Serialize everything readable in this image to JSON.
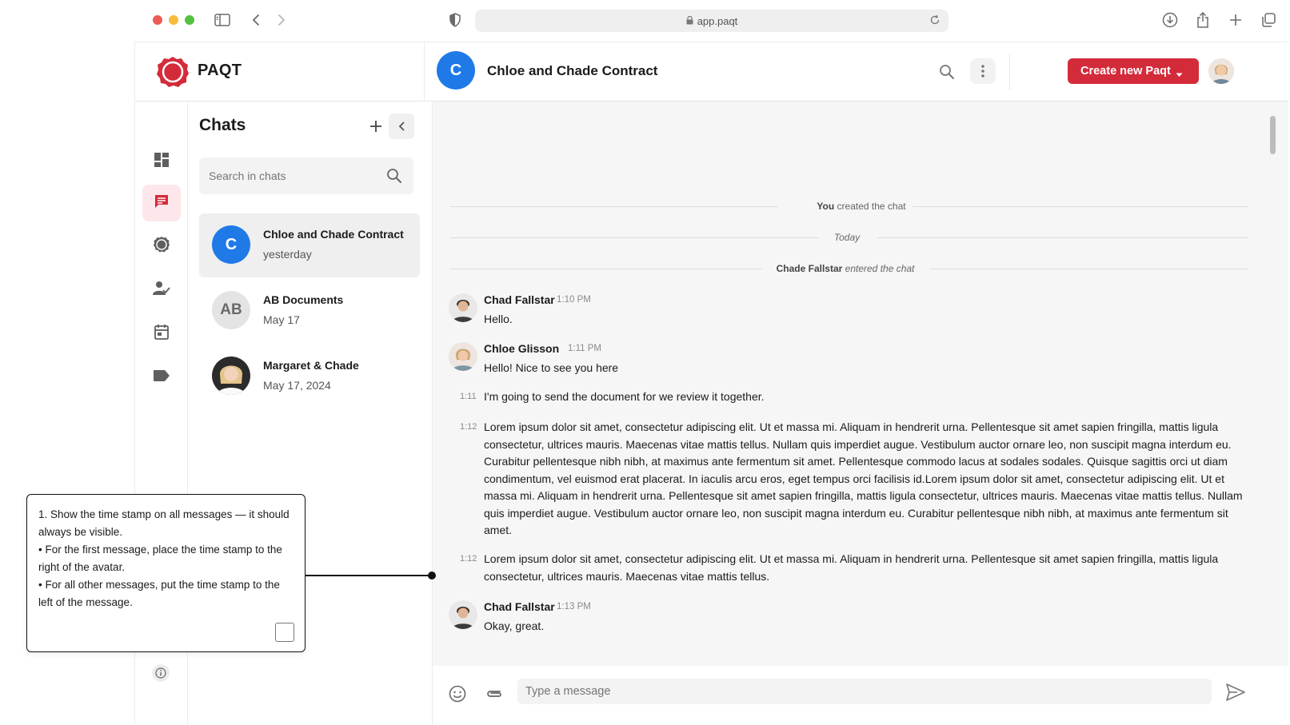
{
  "browser": {
    "url": "app.paqt"
  },
  "app": {
    "brand": "PAQT",
    "header": {
      "chat_avatar_letter": "C",
      "chat_title": "Chloe and Chade Contract",
      "create_button_label": "Create new Paqt"
    },
    "colors": {
      "brand_red": "#d42b3a",
      "avatar_blue": "#1f7ae8",
      "active_nav_bg": "#fde7ea"
    }
  },
  "sidebar": {
    "items": [
      {
        "icon": "dashboard-icon"
      },
      {
        "icon": "chat-icon",
        "active": true
      },
      {
        "icon": "seal-icon"
      },
      {
        "icon": "user-check-icon"
      },
      {
        "icon": "calendar-icon"
      },
      {
        "icon": "tag-icon"
      }
    ],
    "footer_icon": "info-icon"
  },
  "chats": {
    "title": "Chats",
    "search_placeholder": "Search in chats",
    "items": [
      {
        "avatar": "C",
        "title": "Chloe and Chade Contract",
        "subtitle": "yesterday",
        "active": true
      },
      {
        "avatar": "AB",
        "title": "AB Documents",
        "subtitle": "May 17"
      },
      {
        "avatar": "photo",
        "title": "Margaret & Chade",
        "subtitle": "May 17, 2024"
      }
    ]
  },
  "conversation": {
    "system": {
      "created_actor": "You",
      "created_text": "created the chat",
      "date_divider": "Today",
      "entered_actor": "Chade Fallstar",
      "entered_text": "entered the chat"
    },
    "messages": [
      {
        "author": "Chad Fallstar",
        "time": "1:10 PM",
        "text": "Hello."
      },
      {
        "author": "Chloe Glisson",
        "time": "1:11 PM",
        "text": "Hello! Nice to see you here"
      },
      {
        "side_time": "1:11",
        "text": "I'm going to send the document for we review it together."
      },
      {
        "side_time": "1:12",
        "text": "Lorem ipsum dolor sit amet, consectetur adipiscing elit. Ut et massa mi. Aliquam in hendrerit urna. Pellentesque sit amet sapien fringilla, mattis ligula consectetur, ultrices mauris. Maecenas vitae mattis tellus. Nullam quis imperdiet augue. Vestibulum auctor ornare leo, non suscipit magna interdum eu. Curabitur pellentesque nibh nibh, at maximus ante fermentum sit amet. Pellentesque commodo lacus at sodales sodales. Quisque sagittis orci ut diam condimentum, vel euismod erat placerat. In iaculis arcu eros, eget tempus orci facilisis id.Lorem ipsum dolor sit amet, consectetur adipiscing elit. Ut et massa mi. Aliquam in hendrerit urna. Pellentesque sit amet sapien fringilla, mattis ligula consectetur, ultrices mauris. Maecenas vitae mattis tellus. Nullam quis imperdiet augue. Vestibulum auctor ornare leo, non suscipit magna interdum eu. Curabitur pellentesque nibh nibh, at maximus ante fermentum sit amet."
      },
      {
        "side_time": "1:12",
        "text": "Lorem ipsum dolor sit amet, consectetur adipiscing elit. Ut et massa mi. Aliquam in hendrerit urna. Pellentesque sit amet sapien fringilla, mattis ligula consectetur, ultrices mauris. Maecenas vitae mattis tellus."
      },
      {
        "author": "Chad Fallstar",
        "time": "1:13 PM",
        "text": "Okay, great."
      }
    ],
    "composer_placeholder": "Type a message"
  },
  "annotation": {
    "line1": "1. Show the time stamp on all messages — it should always be visible.",
    "line2": "• For the first message, place the time stamp to the right of the avatar.",
    "line3": "• For all other messages, put the time stamp to the left of the message."
  }
}
